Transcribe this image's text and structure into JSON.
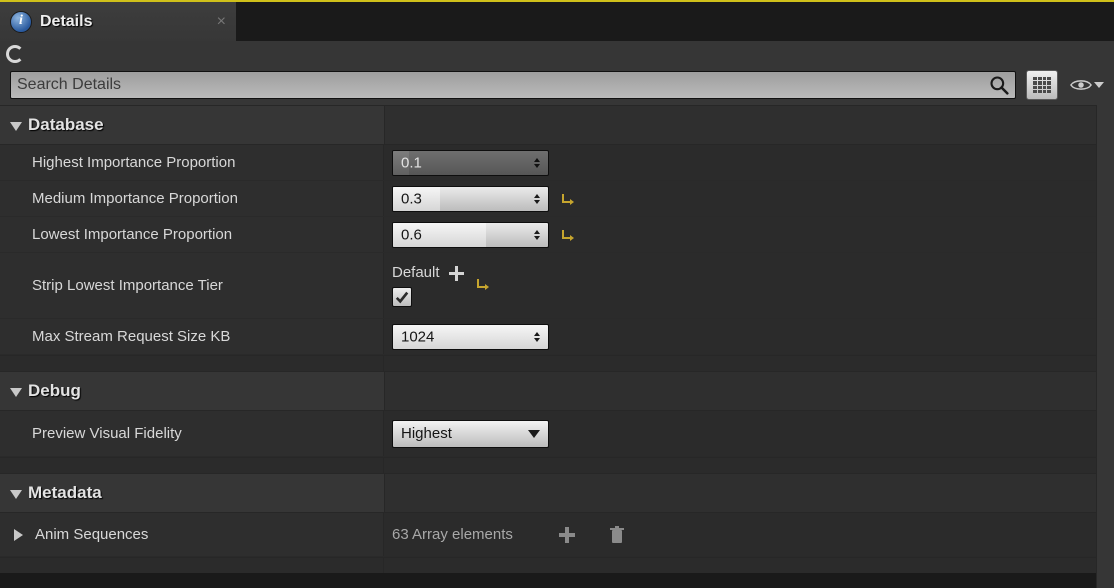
{
  "tab": {
    "title": "Details"
  },
  "search": {
    "placeholder": "Search Details"
  },
  "sections": {
    "database": {
      "title": "Database",
      "rows": {
        "highest": {
          "label": "Highest Importance Proportion",
          "value": "0.1"
        },
        "medium": {
          "label": "Medium Importance Proportion",
          "value": "0.3"
        },
        "lowest": {
          "label": "Lowest Importance Proportion",
          "value": "0.6"
        },
        "strip": {
          "label": "Strip Lowest Importance Tier",
          "default_label": "Default",
          "checked": true
        },
        "maxreq": {
          "label": "Max Stream Request Size KB",
          "value": "1024"
        }
      }
    },
    "debug": {
      "title": "Debug",
      "rows": {
        "fidelity": {
          "label": "Preview Visual Fidelity",
          "value": "Highest"
        }
      }
    },
    "metadata": {
      "title": "Metadata",
      "rows": {
        "anim": {
          "label": "Anim Sequences",
          "array_text": "63 Array elements"
        }
      }
    }
  }
}
